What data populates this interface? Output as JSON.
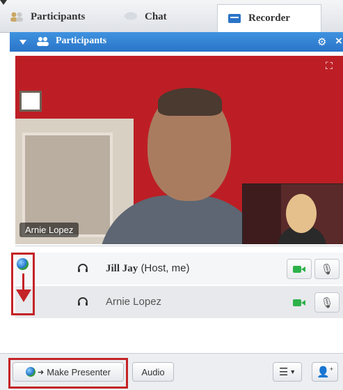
{
  "tabs": [
    {
      "label": "Participants",
      "icon": "participants-icon"
    },
    {
      "label": "Chat",
      "icon": "chat-icon"
    },
    {
      "label": "Recorder",
      "icon": "recorder-icon"
    }
  ],
  "panel": {
    "title": "Participants"
  },
  "video": {
    "name_overlay": "Arnie Lopez"
  },
  "participants": [
    {
      "name": "Jill Jay",
      "role": "(Host, me)"
    },
    {
      "name": "Arnie Lopez",
      "role": ""
    }
  ],
  "toolbar": {
    "make_presenter_label": "Make Presenter",
    "audio_label": "Audio"
  },
  "colors": {
    "accent": "#2a74c8",
    "highlight": "#c42327",
    "video_bg": "#bd1e25",
    "camera": "#2db24a"
  }
}
